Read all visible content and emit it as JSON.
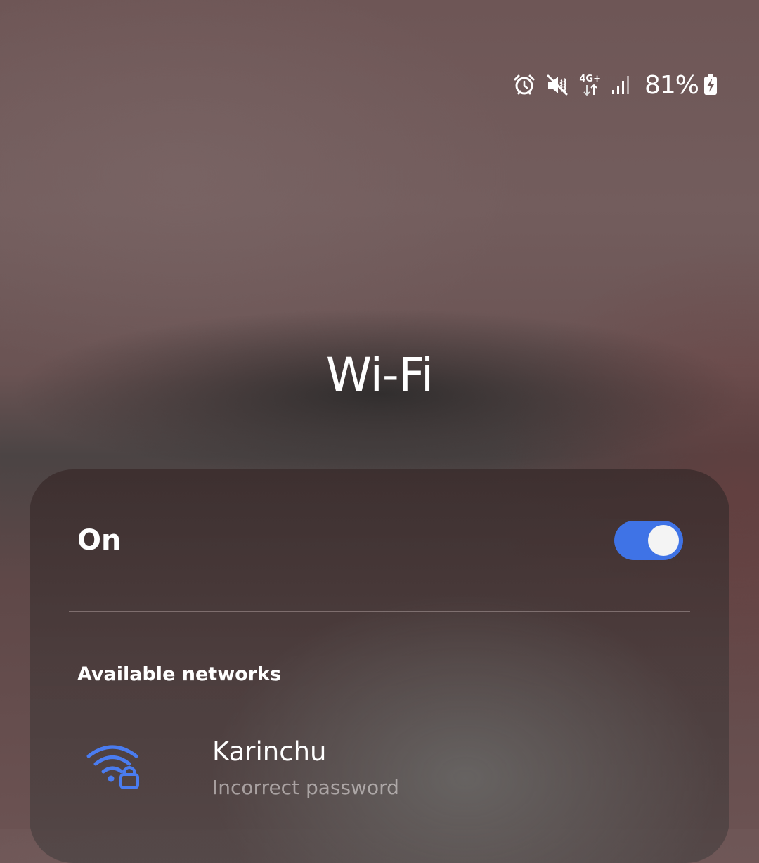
{
  "status_bar": {
    "icons": [
      "alarm-icon",
      "mute-icon",
      "mobile-data-icon",
      "signal-icon",
      "battery-charging-icon"
    ],
    "network_type": "4G+",
    "battery_percent": "81%"
  },
  "header": {
    "title": "Wi-Fi"
  },
  "wifi_toggle": {
    "label": "On",
    "state": "on",
    "accent_color": "#3f73e6"
  },
  "networks": {
    "section_title": "Available networks",
    "items": [
      {
        "name": "Karinchu",
        "status": "Incorrect password",
        "icon": "wifi-lock-icon",
        "icon_color": "#4a7cf0"
      }
    ]
  }
}
